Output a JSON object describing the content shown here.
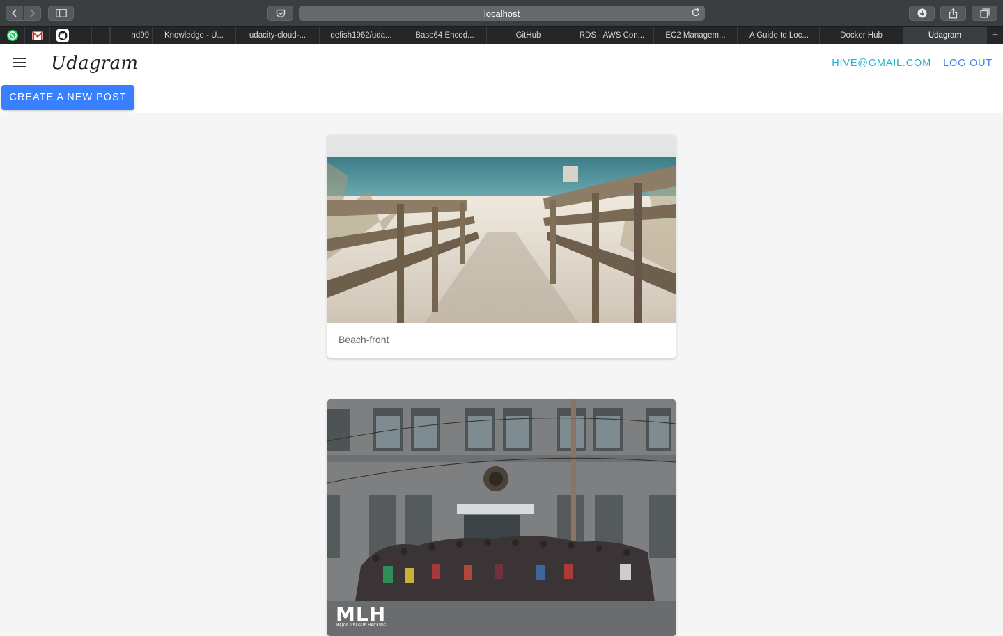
{
  "browser": {
    "url": "localhost",
    "tabs": [
      {
        "label": "nd99"
      },
      {
        "label": "Knowledge - U..."
      },
      {
        "label": "udacity-cloud-..."
      },
      {
        "label": "defish1962/uda..."
      },
      {
        "label": "Base64 Encod..."
      },
      {
        "label": "GitHub"
      },
      {
        "label": "RDS · AWS Con..."
      },
      {
        "label": "EC2 Managem..."
      },
      {
        "label": "A Guide to Loc..."
      },
      {
        "label": "Docker Hub"
      },
      {
        "label": "Udagram",
        "active": true
      }
    ],
    "pinned_tabs": [
      "whatsapp-icon",
      "gmail-icon",
      "github-icon"
    ]
  },
  "app": {
    "title": "Udagram",
    "user_email": "HIVE@GMAIL.COM",
    "logout_label": "LOG OUT",
    "create_post_label": "CREATE A NEW POST"
  },
  "feed": {
    "posts": [
      {
        "caption": "Beach-front",
        "image": "beach boardwalk"
      },
      {
        "caption": "",
        "image": "group photo in front of GitHub building",
        "watermark": "MLH",
        "watermark_sub": "MAJOR LEAGUE HACKING"
      }
    ]
  },
  "colors": {
    "accent": "#3880ff",
    "email": "#1fb3d1",
    "chrome": "#3b3e41"
  }
}
